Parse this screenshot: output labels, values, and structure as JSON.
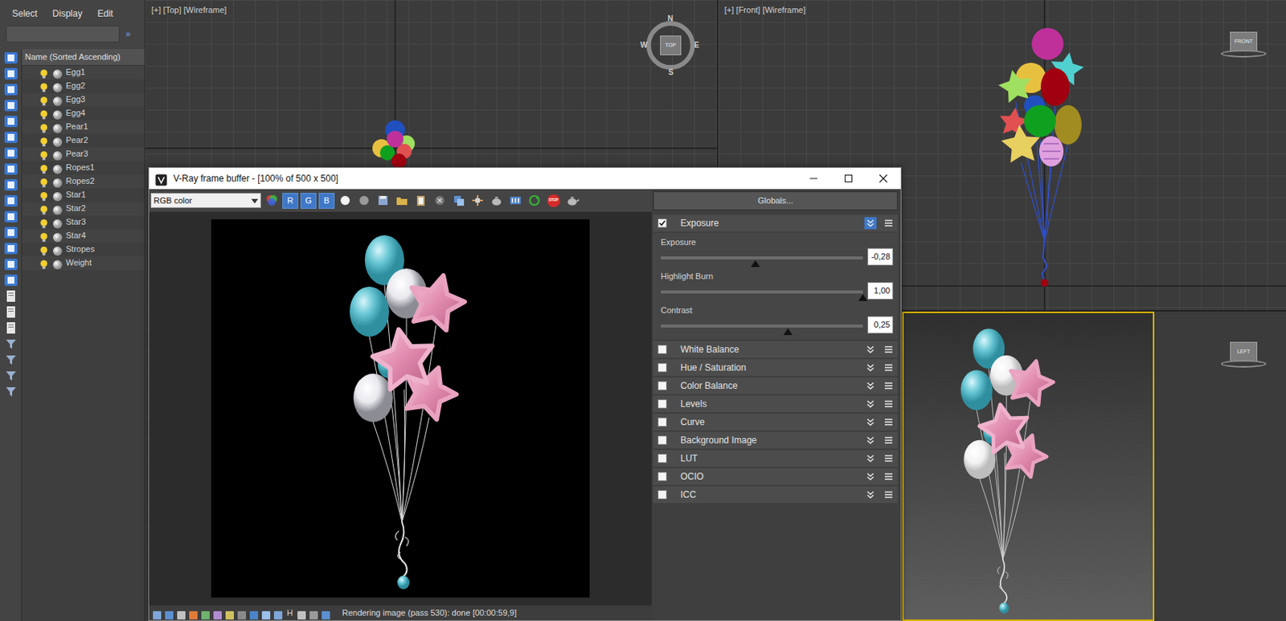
{
  "explorer": {
    "menu": [
      {
        "label": "Select"
      },
      {
        "label": "Display"
      },
      {
        "label": "Edit"
      }
    ],
    "expand": "»",
    "column": "Name (Sorted Ascending)",
    "items": [
      {
        "name": "Egg1",
        "on": true
      },
      {
        "name": "Egg2",
        "on": true
      },
      {
        "name": "Egg3",
        "on": true
      },
      {
        "name": "Egg4",
        "on": true
      },
      {
        "name": "Pear1",
        "on": true
      },
      {
        "name": "Pear2",
        "on": true
      },
      {
        "name": "Pear3",
        "on": true
      },
      {
        "name": "Ropes1",
        "on": true
      },
      {
        "name": "Ropes2",
        "on": true
      },
      {
        "name": "Star1",
        "on": true
      },
      {
        "name": "Star2",
        "on": true
      },
      {
        "name": "Star3",
        "on": true
      },
      {
        "name": "Star4",
        "on": true
      },
      {
        "name": "Stropes",
        "on": true
      },
      {
        "name": "Weight",
        "on": true
      }
    ]
  },
  "viewports": {
    "top": {
      "label": "[+] [Top] [Wireframe]",
      "compass": {
        "north": "N",
        "east": "E",
        "south": "S",
        "west": "W",
        "cube": "TOP"
      }
    },
    "front": {
      "label": "[+] [Front] [Wireframe]",
      "cube": "FRONT"
    },
    "left": {
      "cube": "LEFT",
      "selected": true
    }
  },
  "vfb": {
    "title": "V-Ray frame buffer - [100% of 500 x 500]",
    "channel": "RGB color",
    "rgb": [
      {
        "label": "R",
        "selected": true
      },
      {
        "label": "G",
        "selected": true
      },
      {
        "label": "B",
        "selected": true
      }
    ],
    "stop": "STOP",
    "globals": "Globals...",
    "layers": [
      {
        "label": "Exposure",
        "checked": true,
        "expanded": true,
        "sliders": [
          {
            "label": "Exposure",
            "value": "-0,28",
            "level": 0.47
          },
          {
            "label": "Highlight Burn",
            "value": "1,00",
            "level": 1.0
          },
          {
            "label": "Contrast",
            "value": "0,25",
            "level": 0.63
          }
        ]
      },
      {
        "label": "White Balance",
        "checked": false,
        "expanded": false,
        "sliders": []
      },
      {
        "label": "Hue / Saturation",
        "checked": false,
        "expanded": false,
        "sliders": []
      },
      {
        "label": "Color Balance",
        "checked": false,
        "expanded": false,
        "sliders": []
      },
      {
        "label": "Levels",
        "checked": false,
        "expanded": false,
        "sliders": []
      },
      {
        "label": "Curve",
        "checked": false,
        "expanded": false,
        "sliders": []
      },
      {
        "label": "Background Image",
        "checked": false,
        "expanded": false,
        "sliders": []
      },
      {
        "label": "LUT",
        "checked": false,
        "expanded": false,
        "sliders": []
      },
      {
        "label": "OCIO",
        "checked": false,
        "expanded": false,
        "sliders": []
      },
      {
        "label": "ICC",
        "checked": false,
        "expanded": false,
        "sliders": []
      }
    ],
    "status": {
      "tool": "H",
      "text": "Rendering image (pass 530): done [00:00:59,9]"
    }
  }
}
